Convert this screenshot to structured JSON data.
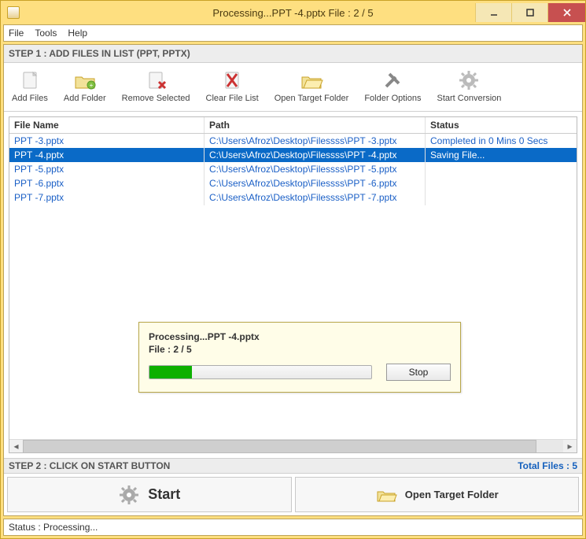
{
  "title": "Processing...PPT -4.pptx File : 2 / 5",
  "menu": {
    "file": "File",
    "tools": "Tools",
    "help": "Help"
  },
  "step1_label": "STEP 1 : ADD FILES IN LIST (PPT, PPTX)",
  "toolbar": {
    "add_files": "Add Files",
    "add_folder": "Add Folder",
    "remove_selected": "Remove Selected",
    "clear_list": "Clear File List",
    "open_target": "Open Target Folder",
    "folder_options": "Folder Options",
    "start_conversion": "Start Conversion"
  },
  "columns": {
    "name": "File Name",
    "path": "Path",
    "status": "Status"
  },
  "rows": [
    {
      "name": "PPT -3.pptx",
      "path": "C:\\Users\\Afroz\\Desktop\\Filessss\\PPT -3.pptx",
      "status": "Completed in 0 Mins 0 Secs",
      "selected": false
    },
    {
      "name": "PPT -4.pptx",
      "path": "C:\\Users\\Afroz\\Desktop\\Filessss\\PPT -4.pptx",
      "status": "Saving File...",
      "selected": true
    },
    {
      "name": "PPT -5.pptx",
      "path": "C:\\Users\\Afroz\\Desktop\\Filessss\\PPT -5.pptx",
      "status": "",
      "selected": false
    },
    {
      "name": "PPT -6.pptx",
      "path": "C:\\Users\\Afroz\\Desktop\\Filessss\\PPT -6.pptx",
      "status": "",
      "selected": false
    },
    {
      "name": "PPT -7.pptx",
      "path": "C:\\Users\\Afroz\\Desktop\\Filessss\\PPT -7.pptx",
      "status": "",
      "selected": false
    }
  ],
  "step2_label": "STEP 2 : CLICK ON START BUTTON",
  "total_label": "Total Files : 5",
  "big": {
    "start": "Start",
    "open_target": "Open Target Folder"
  },
  "statusbar": "Status  :  Processing...",
  "dialog": {
    "line1": "Processing...PPT -4.pptx",
    "line2": "File : 2 / 5",
    "stop": "Stop",
    "progress_percent": 19
  }
}
